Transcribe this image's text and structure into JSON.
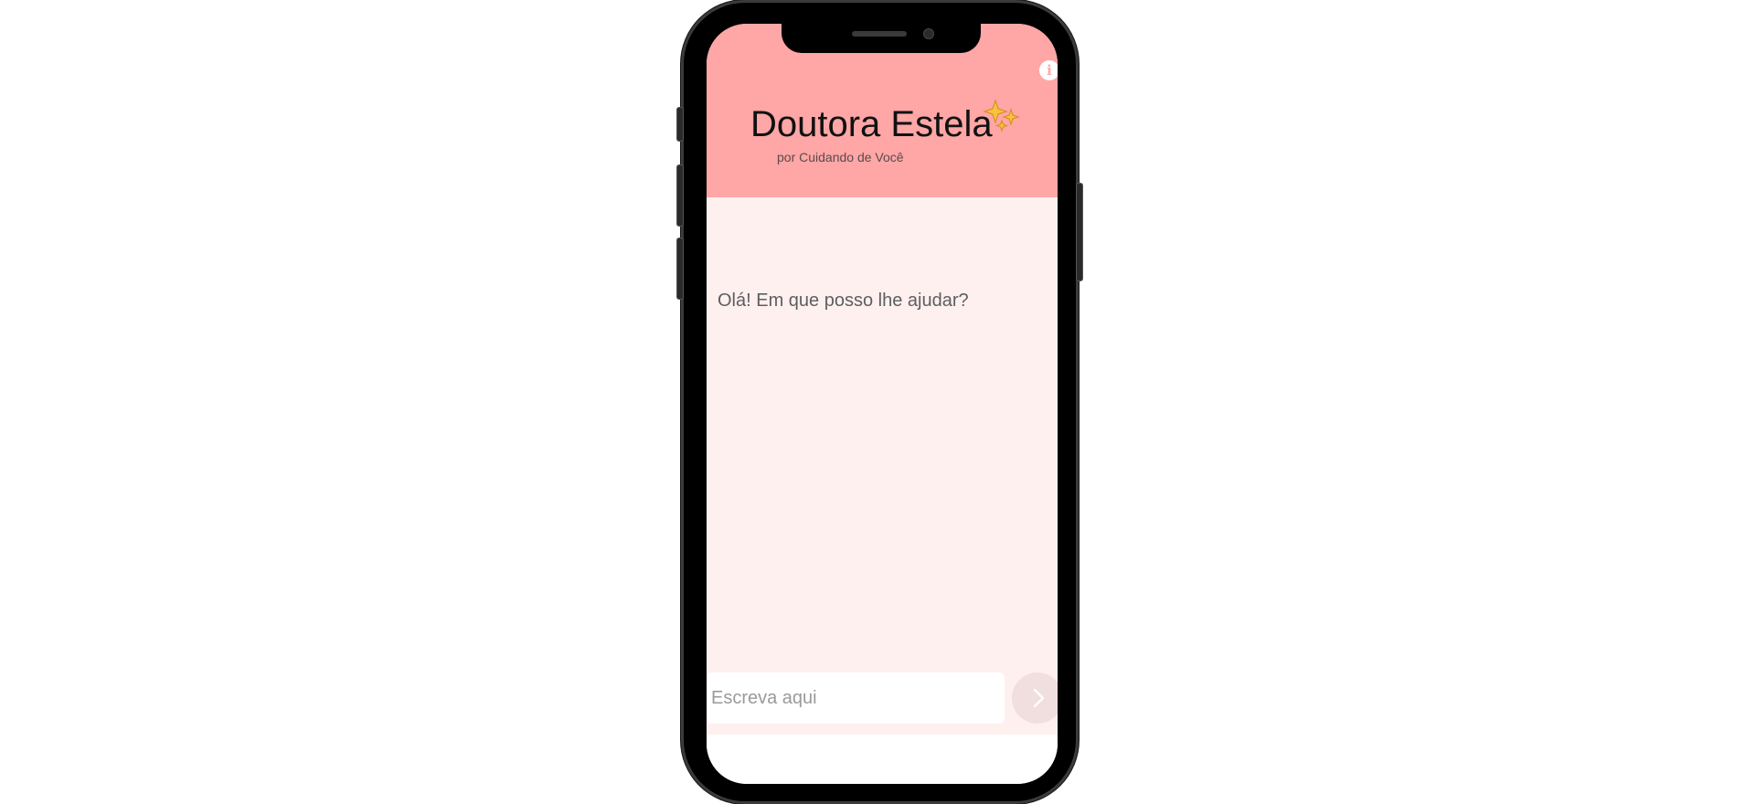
{
  "header": {
    "title": "Doutora Estela",
    "subtitle": "por Cuidando de Você",
    "info_icon": "info-icon",
    "sparkle_icon": "sparkles-icon",
    "background_color": "#ffa6a6"
  },
  "chat": {
    "messages": [
      {
        "from": "bot",
        "text": "Olá! Em que posso lhe ajudar?"
      }
    ],
    "background_color": "#fff0f0"
  },
  "composer": {
    "placeholder": "Escreva aqui",
    "value": "",
    "send_icon": "chevron-right-icon"
  }
}
